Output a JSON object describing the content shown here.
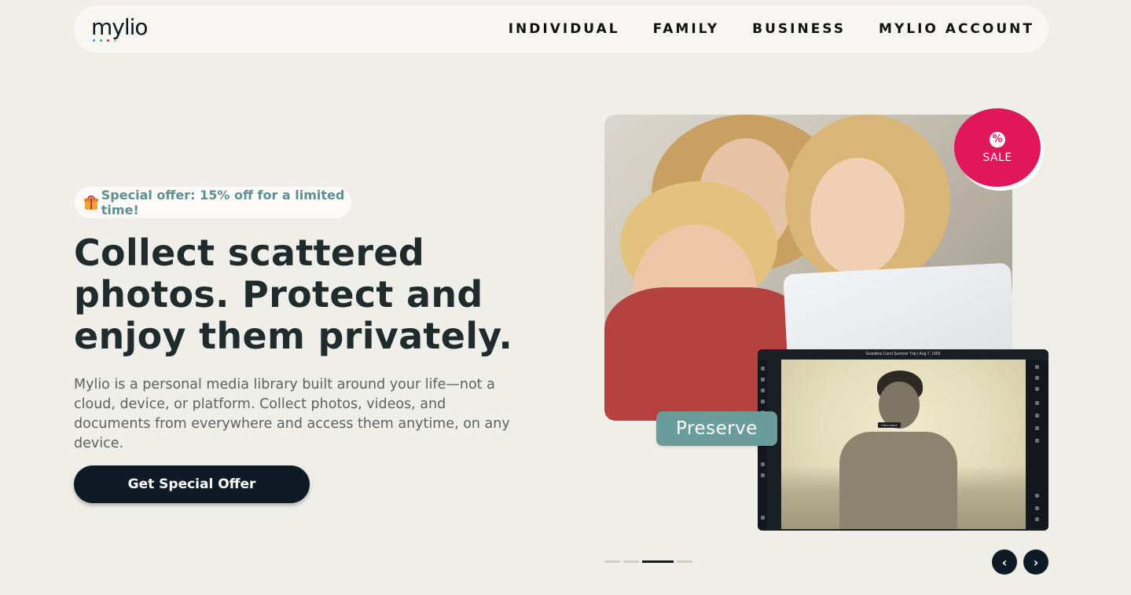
{
  "header": {
    "logo_text": "mylio",
    "logo_dot_colors": [
      "#2aa3d8",
      "#22b07a",
      "#e0175a",
      "#f2a33a"
    ],
    "nav": [
      {
        "label": "INDIVIDUAL"
      },
      {
        "label": "FAMILY"
      },
      {
        "label": "BUSINESS"
      },
      {
        "label": "MYLIO ACCOUNT"
      }
    ]
  },
  "hero": {
    "offer_icon": "gift-icon",
    "offer_text": "Special offer: 15% off for a limited time!",
    "headline_lines": [
      "Collect scattered",
      "photos. Protect and",
      "enjoy them privately."
    ],
    "subtext": "Mylio is a personal media library built around your life—not a cloud, device, or platform. Collect photos, videos, and documents from everywhere and access them anytime, on any device.",
    "cta_label": "Get Special Offer"
  },
  "visual": {
    "sale_icon": "%",
    "sale_label": "SALE",
    "sale_color": "#e0175a",
    "preserve_label": "Preserve",
    "app_title": "Grandma Carol Summer Trip | Aug 7, 1965",
    "name_tag": "Carol name"
  },
  "carousel": {
    "slide_count": 4,
    "active_index": 2,
    "prev_icon": "chevron-left-icon",
    "next_icon": "chevron-right-icon",
    "prev_glyph": "‹",
    "next_glyph": "›"
  },
  "colors": {
    "background": "#efeee9",
    "dark": "#0e1b26",
    "accent_teal": "#6b9c9c",
    "offer_text": "#5e8f91"
  }
}
